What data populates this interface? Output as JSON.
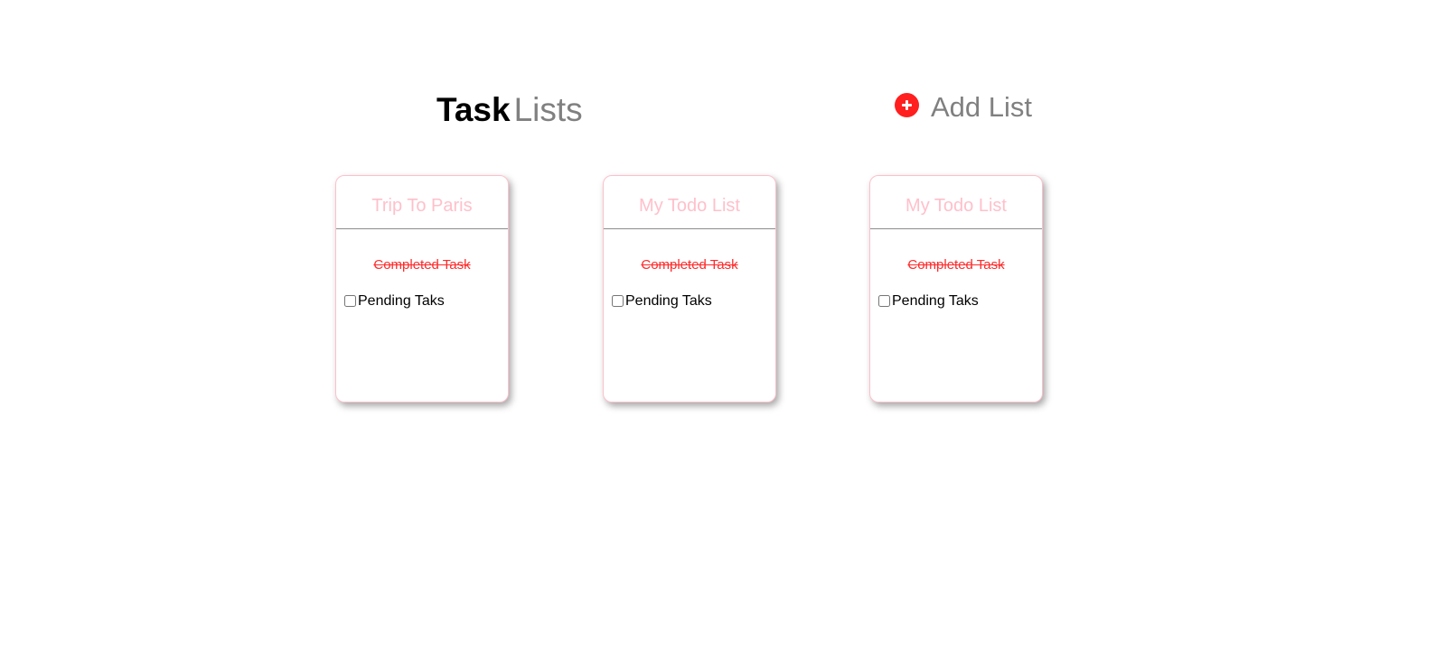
{
  "header": {
    "title_strong": "Task",
    "title_light": "Lists",
    "add_list_label": "Add List",
    "add_list_icon": "plus-circle-icon",
    "accent_color": "#ff1f1f"
  },
  "lists": [
    {
      "title": "Trip To Paris",
      "completed_task": "Completed Task",
      "pending_task": "Pending Taks",
      "pending_checked": false
    },
    {
      "title": "My Todo List",
      "completed_task": "Completed Task",
      "pending_task": "Pending Taks",
      "pending_checked": false
    },
    {
      "title": "My Todo List",
      "completed_task": "Completed Task",
      "pending_task": "Pending Taks",
      "pending_checked": false
    }
  ],
  "colors": {
    "card_title": "#ffc0cb",
    "card_border": "#ffc0cb",
    "completed_text": "#ff2a2a"
  }
}
